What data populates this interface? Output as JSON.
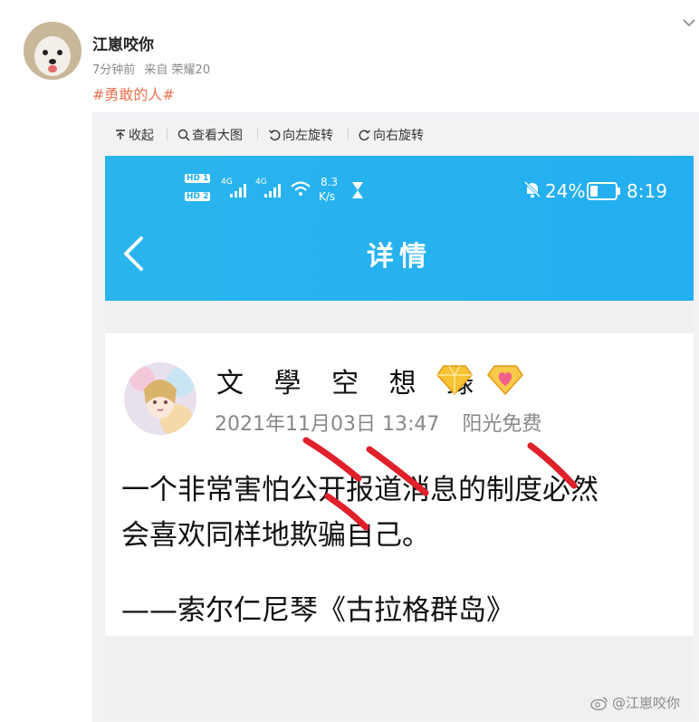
{
  "post": {
    "author": "江崽咬你",
    "time": "7分钟前",
    "source": "来自 荣耀20",
    "hashtag": "#勇敢的人#"
  },
  "toolbar": {
    "collapse": "收起",
    "view_large": "查看大图",
    "rotate_left": "向左旋转",
    "rotate_right": "向右旋转"
  },
  "phone": {
    "hd1": "HD 1",
    "hd2": "HD 2",
    "net1": "4G",
    "net2": "4G",
    "speed_value": "8.3",
    "speed_unit": "K/s",
    "battery": "24%",
    "clock": "8:19",
    "page_title": "详情"
  },
  "card": {
    "name": "文 學 空 想 錄",
    "date": "2021年11月03日 13:47",
    "source": "阳光免费",
    "line1": "一个非常害怕公开报道消息的制度必然",
    "line2": "会喜欢同样地欺骗自己。",
    "quote": "——索尔仁尼琴《古拉格群岛》"
  },
  "watermark": "@江崽咬你",
  "colors": {
    "hashtag": "#eb7350",
    "phone_header": "#2ab5ee",
    "strike": "#e0202a"
  }
}
